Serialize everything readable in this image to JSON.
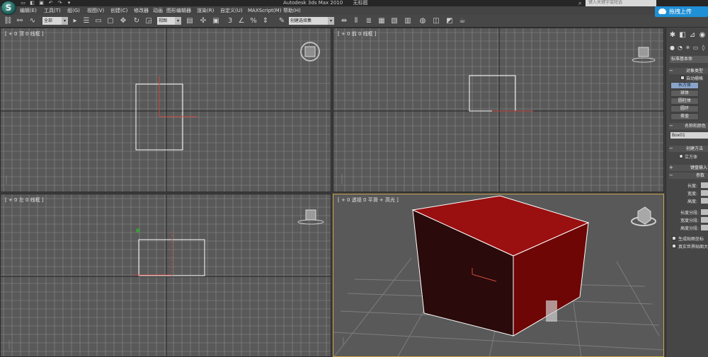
{
  "title_bar": {
    "app_title": "Autodesk 3ds Max  2010",
    "doc_title": "无标题",
    "search_placeholder": "键入关键字或短语",
    "upload_label": "拖拽上传"
  },
  "menu": [
    "编辑(E)",
    "工具(T)",
    "组(G)",
    "视图(V)",
    "创建(C)",
    "修改器",
    "动画",
    "图形编辑器",
    "渲染(R)",
    "自定义(U)",
    "MAXScript(M)",
    "帮助(H)"
  ],
  "toolbar": {
    "filter_select": "全部",
    "refcoord_select": "视图",
    "selection_set_placeholder": "创建选择集",
    "snap_label": "3"
  },
  "viewports": {
    "top_label": "[ + 0 顶 0 线框 ]",
    "front_label": "[ + 0 前 0 线框 ]",
    "left_label": "[ + 0 左 0 线框 ]",
    "persp_label": "[ + 0 透视 0 平滑 + 高光 ]"
  },
  "command_panel": {
    "category": "标准基本体",
    "object_type_title": "对象类型",
    "autogrid_label": "自动栅格",
    "object_buttons": [
      "长方体",
      "球体",
      "圆柱体",
      "圆环",
      "茶壶"
    ],
    "name_color_title": "名称和颜色",
    "object_name": "Box01",
    "creation_method_title": "创建方法",
    "creation_method_option": "立方体",
    "keyboard_entry_title": "键盘输入",
    "params_title": "参数",
    "params": [
      "长度:",
      "宽度:",
      "高度:",
      "长度分段:",
      "宽度分段:",
      "高度分段:"
    ],
    "gen_mapping_label": "生成贴图坐标",
    "real_world_label": "真实世界贴图大小"
  },
  "colors": {
    "viewport_bg": "#595959",
    "grid_line": "#8a8a8a",
    "box_red": "#8b0000",
    "active_border": "#c8a64a"
  }
}
